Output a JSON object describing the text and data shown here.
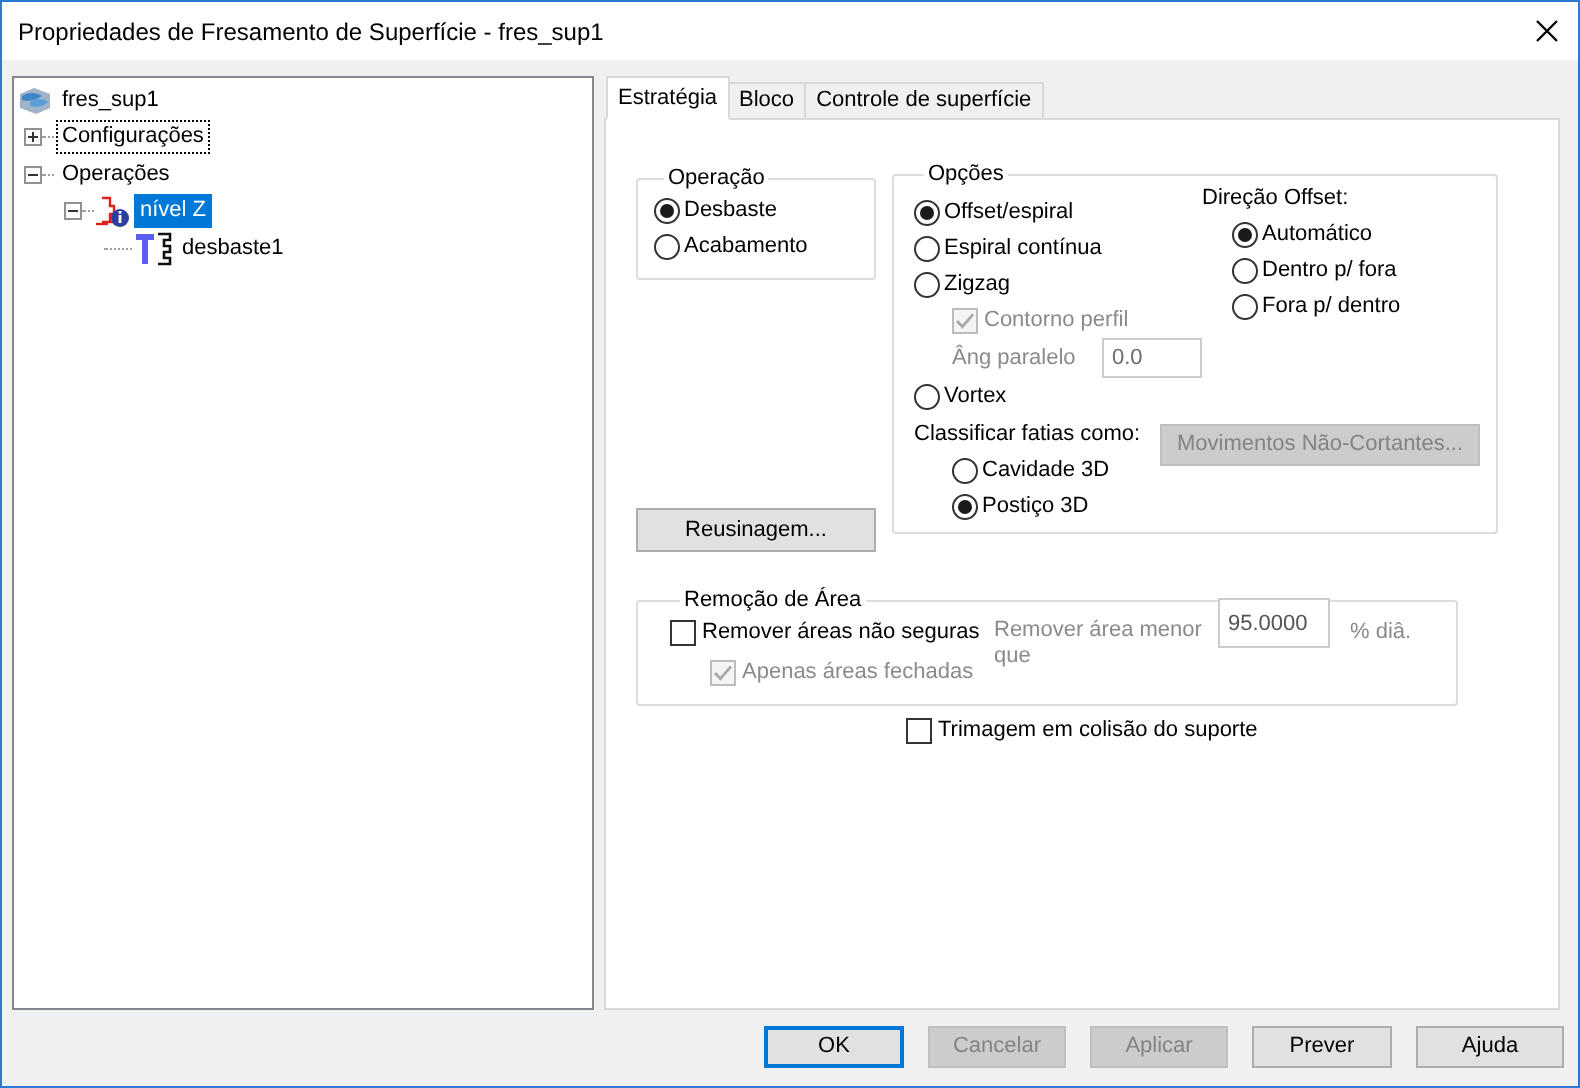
{
  "window": {
    "title": "Propriedades de Fresamento de Superfície - fres_sup1"
  },
  "tree": [
    {
      "label": "fres_sup1",
      "kind": "model",
      "selected": false,
      "children": [
        {
          "label": "Configurações",
          "expanded": false,
          "focused": true,
          "selected": false
        },
        {
          "label": "Operações",
          "expanded": true,
          "selected": false,
          "children": [
            {
              "label": "nível Z",
              "kind": "operation",
              "expanded": true,
              "selected": true,
              "children": [
                {
                  "label": "desbaste1",
                  "kind": "toolpath",
                  "selected": false
                }
              ]
            }
          ]
        }
      ]
    }
  ],
  "tabs": [
    {
      "label": "Estratégia",
      "selected": true
    },
    {
      "label": "Bloco",
      "selected": false
    },
    {
      "label": "Controle de superfície",
      "selected": false
    }
  ],
  "operation": {
    "title": "Operação",
    "options": [
      {
        "label": "Desbaste",
        "selected": true
      },
      {
        "label": "Acabamento",
        "selected": false
      }
    ]
  },
  "rework_button": {
    "label": "Reusinagem..."
  },
  "options": {
    "title": "Opções",
    "strategies": [
      {
        "label": "Offset/espiral",
        "selected": true
      },
      {
        "label": "Espiral contínua",
        "selected": false
      },
      {
        "label": "Zigzag",
        "selected": false,
        "contour": {
          "label": "Contorno perfil",
          "checked": true,
          "disabled": true
        },
        "angle": {
          "label": "Âng paralelo",
          "value": "0.0",
          "disabled": true
        }
      },
      {
        "label": "Vortex",
        "selected": false
      }
    ],
    "direction": {
      "title": "Direção Offset:",
      "options": [
        {
          "label": "Automático",
          "selected": true
        },
        {
          "label": "Dentro p/ fora",
          "selected": false
        },
        {
          "label": "Fora p/ dentro",
          "selected": false
        }
      ]
    },
    "slices": {
      "label": "Classificar fatias como:",
      "options": [
        {
          "label": "Cavidade 3D",
          "selected": false
        },
        {
          "label": "Postiço 3D",
          "selected": true
        }
      ]
    },
    "noncutting_button": {
      "label": "Movimentos Não-Cortantes...",
      "disabled": true
    }
  },
  "area_removal": {
    "title": "Remoção de Área",
    "unsafe": {
      "label": "Remover áreas não seguras",
      "checked": false,
      "disabled": false
    },
    "closed_only": {
      "label": "Apenas áreas fechadas",
      "checked": true,
      "disabled": true
    },
    "min_area": {
      "label": "Remover área menor que",
      "value": "95.0000",
      "unit": "% diâ.",
      "disabled": true
    }
  },
  "support_trim": {
    "label": "Trimagem em colisão do suporte",
    "checked": false,
    "disabled": false
  },
  "buttons": [
    {
      "label": "OK",
      "default": true,
      "disabled": false
    },
    {
      "label": "Cancelar",
      "default": false,
      "disabled": true
    },
    {
      "label": "Aplicar",
      "default": false,
      "disabled": true
    },
    {
      "label": "Prever",
      "default": false,
      "disabled": false
    },
    {
      "label": "Ajuda",
      "default": false,
      "disabled": false
    }
  ]
}
